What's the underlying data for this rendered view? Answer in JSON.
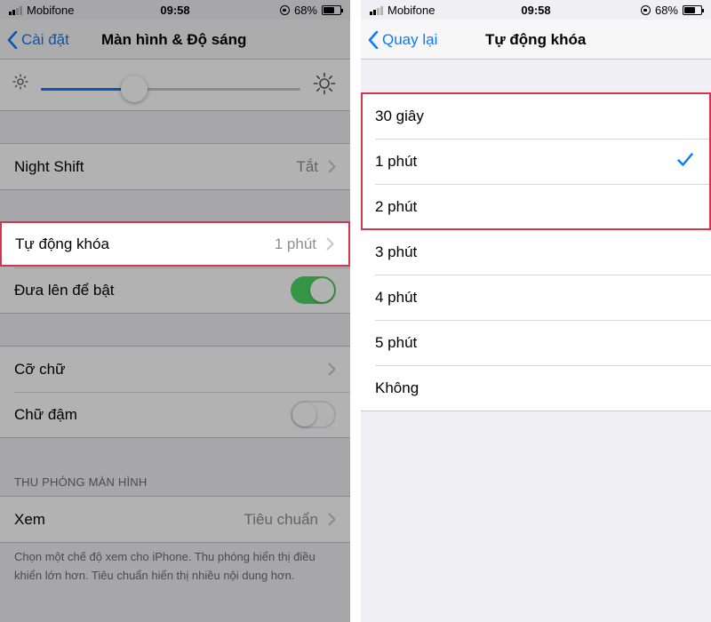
{
  "left": {
    "status": {
      "carrier": "Mobifone",
      "time": "09:58",
      "battery": "68%",
      "battery_level": 0.68
    },
    "nav": {
      "back_label": "Cài đặt",
      "title": "Màn hình & Độ sáng"
    },
    "brightness": {
      "level": 0.36
    },
    "rows": {
      "night_shift": {
        "label": "Night Shift",
        "value": "Tắt"
      },
      "auto_lock": {
        "label": "Tự động khóa",
        "value": "1 phút"
      },
      "raise_to_wake": {
        "label": "Đưa lên để bật",
        "on": true
      },
      "text_size": {
        "label": "Cỡ chữ"
      },
      "bold_text": {
        "label": "Chữ đậm",
        "on": false
      },
      "view": {
        "label": "Xem",
        "value": "Tiêu chuẩn"
      }
    },
    "zoom_section": {
      "header": "THU PHÓNG MÀN HÌNH",
      "footer": "Chọn một chế độ xem cho iPhone. Thu phóng hiển thị điều khiển lớn hơn. Tiêu chuẩn hiển thị nhiều nội dung hơn."
    }
  },
  "right": {
    "status": {
      "carrier": "Mobifone",
      "time": "09:58",
      "battery": "68%",
      "battery_level": 0.68
    },
    "nav": {
      "back_label": "Quay lại",
      "title": "Tự động khóa"
    },
    "options": [
      "30 giây",
      "1 phút",
      "2 phút",
      "3 phút",
      "4 phút",
      "5 phút",
      "Không"
    ],
    "selected_index": 1
  },
  "colors": {
    "accent": "#0a7bff",
    "highlight": "#d2374b",
    "switch_on": "#4cd964"
  }
}
